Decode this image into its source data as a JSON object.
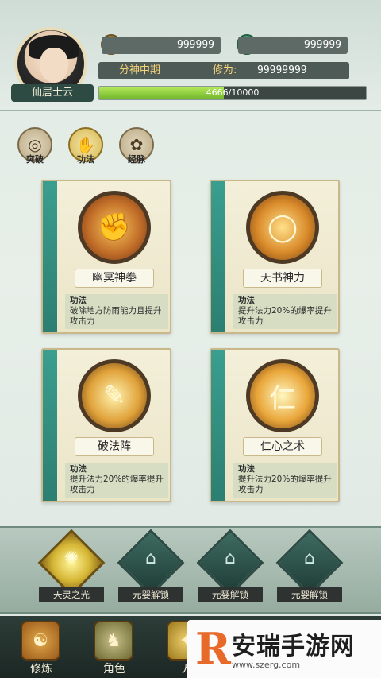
{
  "player": {
    "name": "仙居士云",
    "copper": "999999",
    "jade": "999999",
    "realm": "分神中期",
    "cultivation_label": "修为:",
    "cultivation_value": "99999999",
    "exp_text": "4666/10000",
    "exp_fraction": 0.4666
  },
  "tabs": [
    {
      "label": "突破",
      "icon": "breakthrough-icon"
    },
    {
      "label": "功法",
      "icon": "technique-icon"
    },
    {
      "label": "经脉",
      "icon": "meridian-icon"
    }
  ],
  "skills": [
    {
      "name": "幽冥神拳",
      "desc_label": "功法",
      "desc": "破除地方防雨能力且提升攻击力",
      "icon": "fist-icon"
    },
    {
      "name": "天书神力",
      "desc_label": "功法",
      "desc": "提升法力20%的爆率提升攻击力",
      "icon": "ring-icon"
    },
    {
      "name": "破法阵",
      "desc_label": "功法",
      "desc": "提升法力20%的爆率提升攻击力",
      "icon": "scroll-icon"
    },
    {
      "name": "仁心之术",
      "desc_label": "功法",
      "desc": "提升法力20%的爆率提升攻击力",
      "icon": "ren-icon"
    }
  ],
  "slots": [
    {
      "label": "天灵之光",
      "icon": "light-icon",
      "active": true
    },
    {
      "label": "元婴解锁",
      "icon": "lock-icon",
      "active": false
    },
    {
      "label": "元婴解锁",
      "icon": "lock-icon",
      "active": false
    },
    {
      "label": "元婴解锁",
      "icon": "lock-icon",
      "active": false
    }
  ],
  "nav": [
    {
      "label": "修炼",
      "icon": "cultivate-icon"
    },
    {
      "label": "角色",
      "icon": "character-icon"
    },
    {
      "label": "万",
      "icon": "more-icon"
    }
  ],
  "watermark": {
    "title": "安瑞手游网",
    "url": "www.szerg.com"
  },
  "colors": {
    "accent_teal": "#3a9e8e",
    "exp_green": "#8fd23a",
    "realm_gold": "#f6d47a"
  }
}
